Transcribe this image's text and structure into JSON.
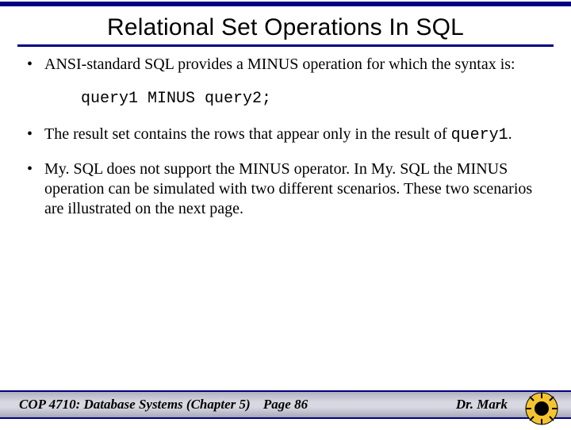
{
  "title": "Relational Set Operations In SQL",
  "bullets": {
    "b1": "ANSI-standard SQL provides a MINUS operation for which the syntax is:",
    "code": "query1 MINUS query2;",
    "b2a": "The result set contains the rows that appear only in the result of ",
    "b2code": "query1",
    "b2b": ".",
    "b3": "My. SQL does not support the MINUS operator.  In My. SQL the MINUS operation can be simulated with two different scenarios.  These two scenarios are illustrated on the next page."
  },
  "footer": {
    "left": "COP 4710: Database Systems  (Chapter 5)",
    "center": "Page 86",
    "right": "Dr. Mark",
    "below": ""
  }
}
